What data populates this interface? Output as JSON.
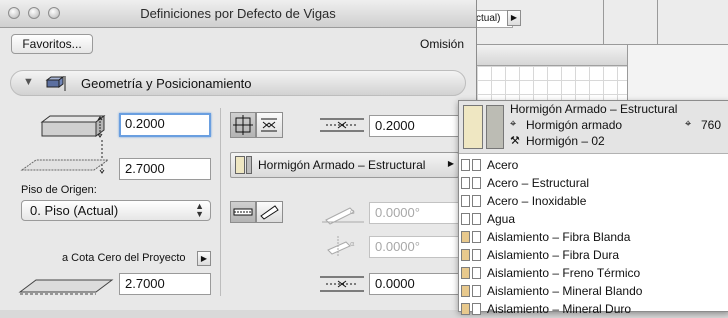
{
  "dialog": {
    "title": "Definiciones por Defecto de Vigas",
    "favorites_label": "Favoritos...",
    "omission_label": "Omisión"
  },
  "background_window": {
    "story_value": "ctual)"
  },
  "section": {
    "title": "Geometría y Posicionamiento"
  },
  "geometry": {
    "width_value": "0.2000",
    "height_value": "2.7000",
    "home_story_label": "Piso de Origen:",
    "home_story_value": "0. Piso (Actual)",
    "reference_label": "a Cota Cero del Proyecto",
    "reference_value": "2.7000"
  },
  "material": {
    "selected_label": "Hormigón Armado – Estructural"
  },
  "right_fields": {
    "offset_value": "0.2000",
    "slant_angle_value": "0.0000°",
    "tilt_angle_value": "0.0000°",
    "bottom_value": "0.0000"
  },
  "popup": {
    "header_title": "Hormigón Armado – Estructural",
    "header_fill": "Hormigón armado",
    "header_pen": "760",
    "header_material": "Hormigón – 02",
    "items": [
      {
        "label": "Acero",
        "swatch": "#ffffff"
      },
      {
        "label": "Acero – Estructural",
        "swatch": "#ffffff"
      },
      {
        "label": "Acero – Inoxidable",
        "swatch": "#ffffff"
      },
      {
        "label": "Agua",
        "swatch": "#ffffff"
      },
      {
        "label": "Aislamiento – Fibra Blanda",
        "swatch": "#e8c98d"
      },
      {
        "label": "Aislamiento – Fibra Dura",
        "swatch": "#e8c98d"
      },
      {
        "label": "Aislamiento – Freno Térmico",
        "swatch": "#e8c98d"
      },
      {
        "label": "Aislamiento – Mineral Blando",
        "swatch": "#e8c98d"
      },
      {
        "label": "Aislamiento – Mineral Duro",
        "swatch": "#e8c98d"
      }
    ]
  }
}
